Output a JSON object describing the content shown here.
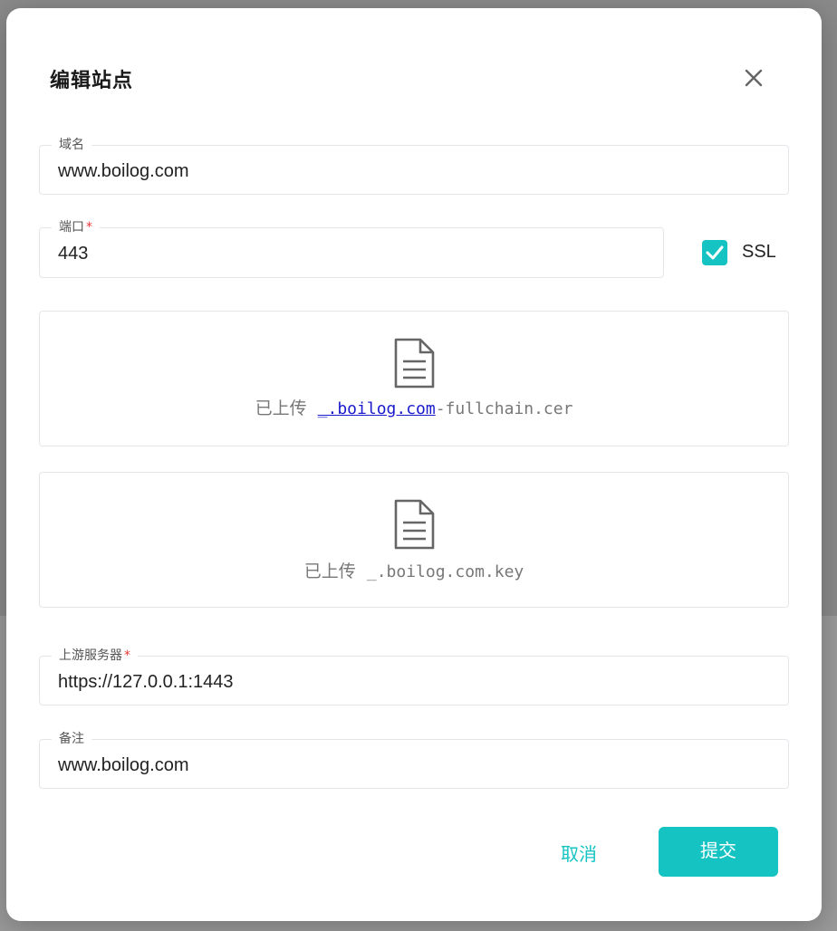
{
  "dialog": {
    "title": "编辑站点",
    "close_icon": "close-icon"
  },
  "fields": {
    "domain": {
      "label": "域名",
      "value": "www.boilog.com"
    },
    "port": {
      "label": "端口",
      "required_mark": "*",
      "value": "443"
    },
    "upstream": {
      "label": "上游服务器",
      "required_mark": "*",
      "value": "https://127.0.0.1:1443"
    },
    "note": {
      "label": "备注",
      "value": "www.boilog.com"
    }
  },
  "ssl": {
    "label": "SSL",
    "checked": true
  },
  "uploads": {
    "cert": {
      "prefix": "已上传",
      "filename_link": "_.boilog.com",
      "filename_rest": "-fullchain.cer",
      "icon": "file-icon"
    },
    "key": {
      "prefix": "已上传",
      "filename": "_.boilog.com.key",
      "icon": "file-icon"
    }
  },
  "actions": {
    "cancel_label": "取消",
    "submit_label": "提交"
  },
  "colors": {
    "accent": "#15c3c3",
    "required": "#e53935",
    "link": "#1a1acc"
  }
}
